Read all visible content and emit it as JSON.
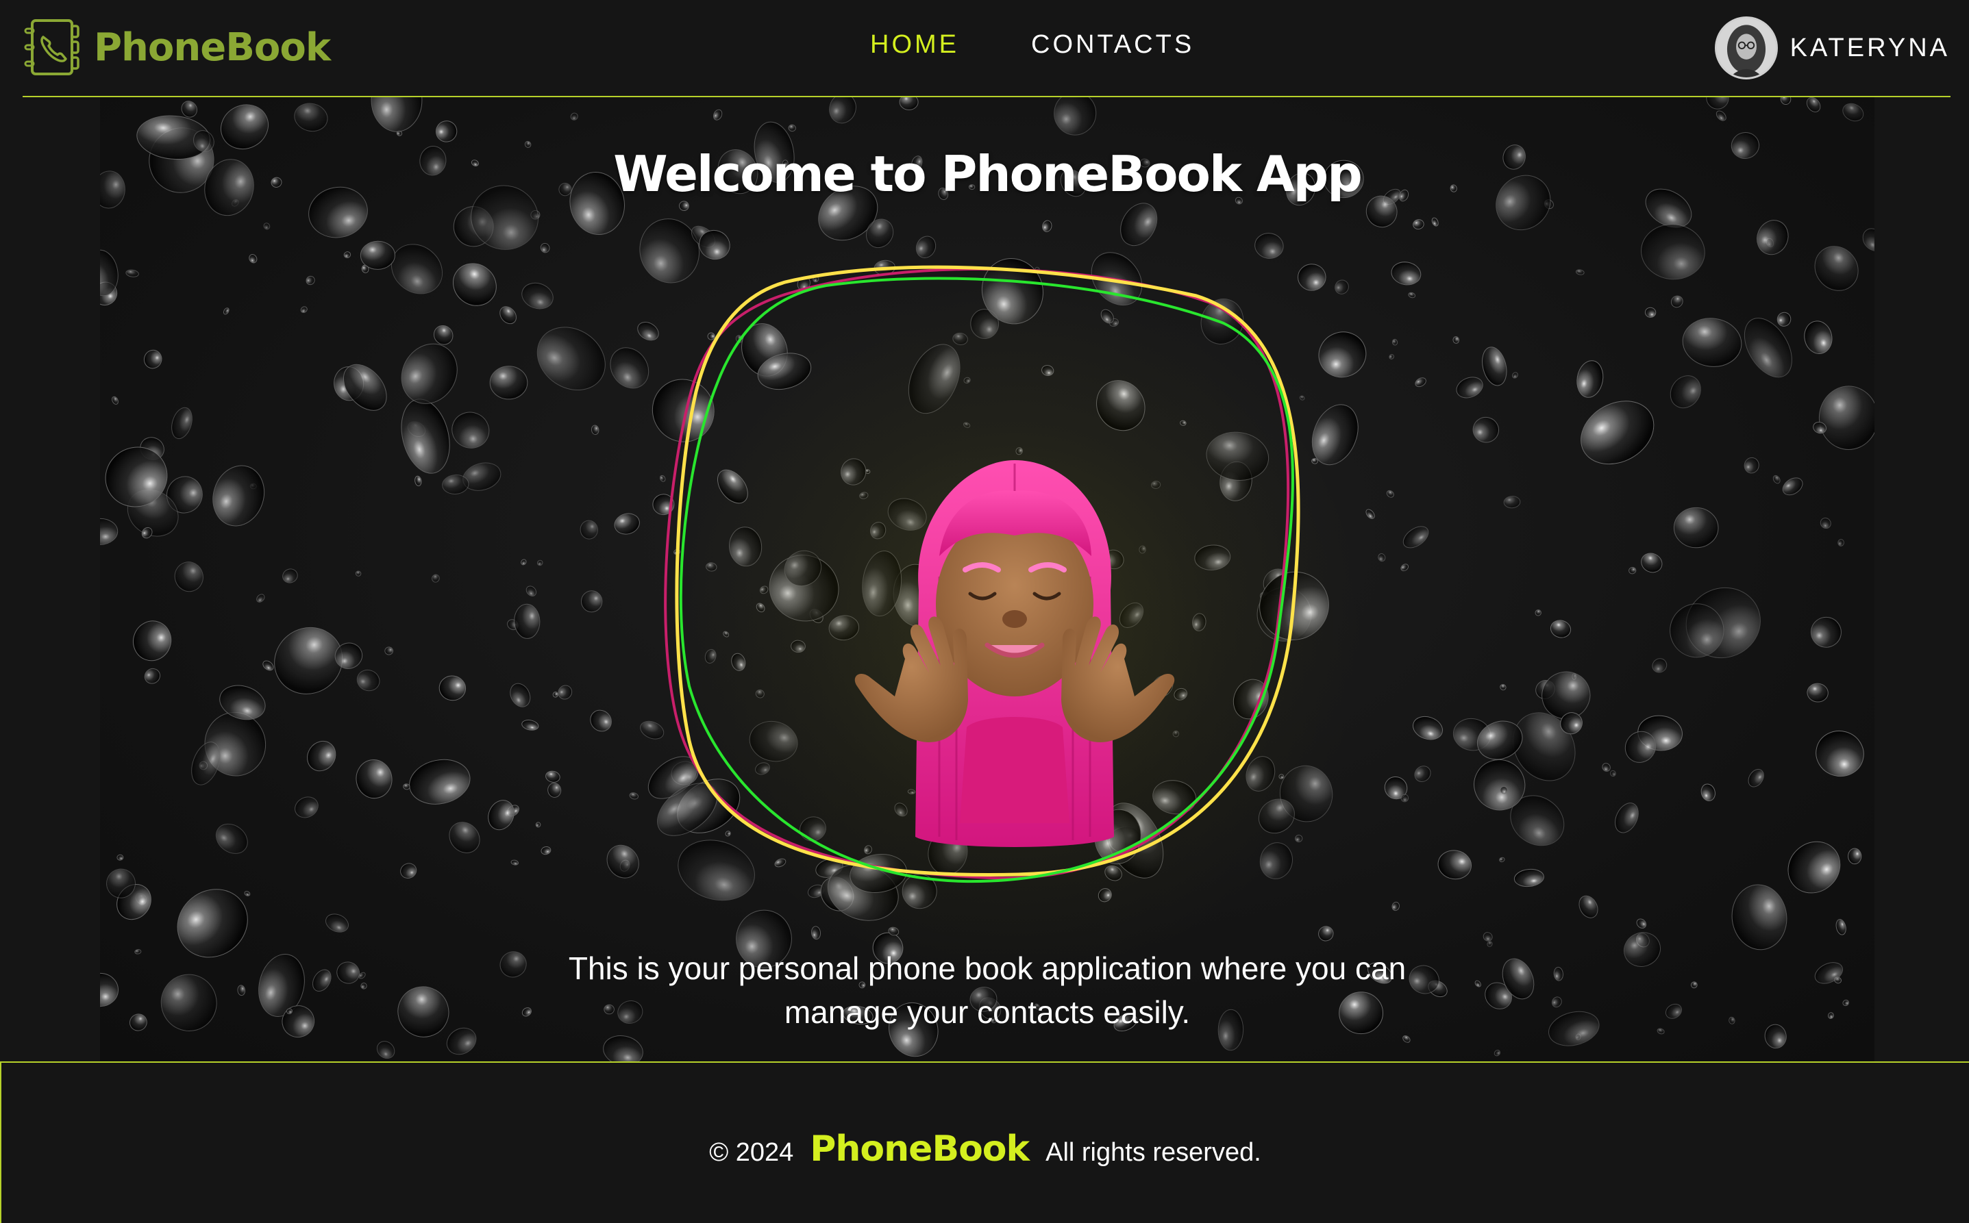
{
  "header": {
    "logo_text": "PhoneBook",
    "nav": [
      {
        "label": "HOME",
        "active": true
      },
      {
        "label": "CONTACTS",
        "active": false
      }
    ],
    "user_name": "KATERYNA"
  },
  "hero": {
    "title": "Welcome to PhoneBook App",
    "description_line1": "This is your personal phone book application where you can",
    "description_line2": "manage your contacts easily."
  },
  "footer": {
    "copyright": "© 2024",
    "logo_text": "PhoneBook",
    "rights": "All rights reserved."
  },
  "colors": {
    "background": "#151515",
    "accent": "#d4ef1f",
    "logo_green": "#8ba834",
    "divider": "#b6d12a",
    "ring_yellow": "#ffe24a",
    "ring_green": "#29e62e",
    "ring_magenta": "#c81f6a"
  }
}
